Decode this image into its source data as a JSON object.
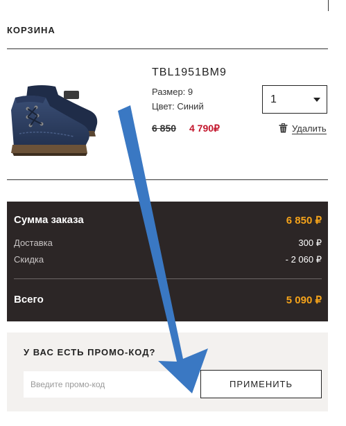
{
  "cart": {
    "title": "КОРЗИНА"
  },
  "product": {
    "image_icon": "ankle-boot-image",
    "sku": "TBL1951BM9",
    "size_text": "Размер: 9",
    "color_text": "Цвет: Синий",
    "price_old": "6 850",
    "price_new": "4 790₽",
    "quantity": "1",
    "delete_label": "Удалить",
    "delete_icon": "trash-icon"
  },
  "summary": {
    "order_label": "Сумма заказа",
    "order_value": "6 850 ₽",
    "delivery_label": "Доставка",
    "delivery_value": "300 ₽",
    "discount_label": "Скидка",
    "discount_value": "- 2 060 ₽",
    "total_label": "Всего",
    "total_value": "5 090 ₽"
  },
  "promo": {
    "title": "У ВАС ЕСТЬ ПРОМО-КОД?",
    "placeholder": "Введите промо-код",
    "apply_label": "ПРИМЕНИТЬ"
  },
  "overlay": {
    "arrow_icon": "blue-arrow-annotation"
  },
  "colors": {
    "accent": "#f5a31a",
    "sale_price": "#c3162c",
    "summary_bg": "#2c2626",
    "promo_bg": "#f3f1ef",
    "arrow": "#3a78c3"
  }
}
